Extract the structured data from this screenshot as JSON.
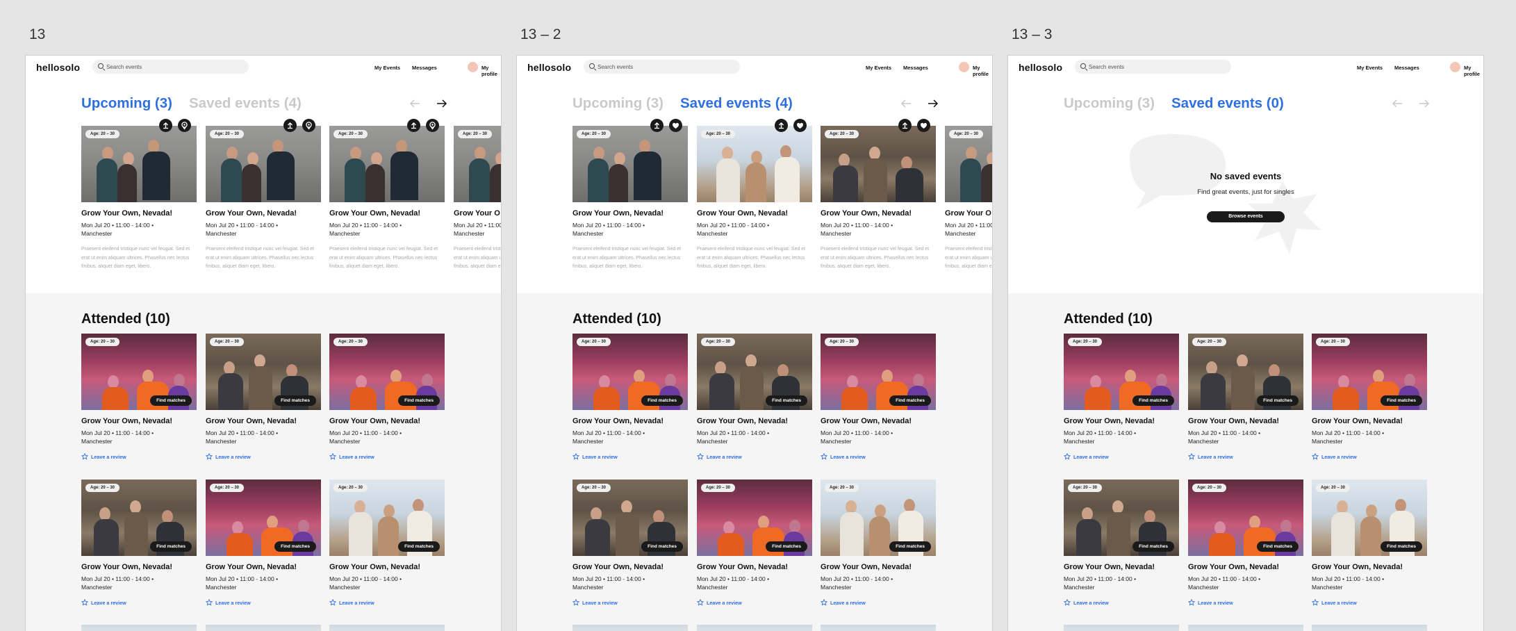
{
  "frames": [
    {
      "label": "13",
      "upcoming_tab": "Upcoming (3)",
      "saved_tab": "Saved events (4)",
      "active": "upcoming",
      "saved_state": "list",
      "circle_icons": [
        "share-icon",
        "pin-icon"
      ],
      "arrow_prev_enabled": false,
      "arrow_next_enabled": true
    },
    {
      "label": "13 – 2",
      "upcoming_tab": "Upcoming (3)",
      "saved_tab": "Saved events (4)",
      "active": "saved",
      "saved_state": "list",
      "circle_icons": [
        "share-icon",
        "heart-icon"
      ],
      "arrow_prev_enabled": false,
      "arrow_next_enabled": true
    },
    {
      "label": "13 – 3",
      "upcoming_tab": "Upcoming (3)",
      "saved_tab": "Saved events (0)",
      "active": "saved",
      "saved_state": "empty",
      "circle_icons": [],
      "arrow_prev_enabled": false,
      "arrow_next_enabled": false
    }
  ],
  "nav": {
    "logo": "hellosolo",
    "search_placeholder": "Search events",
    "my_events": "My Events",
    "messages": "Messages",
    "my_profile": "My profile"
  },
  "event": {
    "age": "Age: 20 – 30",
    "title": "Grow Your Own, Nevada!",
    "title_clipped": "Grow Your O",
    "meta_1": "Mon Jul 20 • 11:00 - 14:00 •",
    "meta_2": "Manchester",
    "desc": "Praesent eleifend tristique nunc vel feugiat. Sed et erat ut enim aliquam ultrices. Phasellus nec lectus finibus, aliquet diam eget, libero.",
    "find_matches": "Find matches",
    "leave_review": "Leave a review"
  },
  "attended_title": "Attended (10)",
  "empty_state": {
    "title": "No saved events",
    "subtitle": "Find great events, just for singles",
    "button": "Browse events"
  },
  "colors": {
    "accent": "#2f6fe0",
    "inactive_tab": "#c9c9c9",
    "dark": "#1a1a1a",
    "section_bg": "#f5f5f5",
    "canvas": "#e5e5e5"
  }
}
